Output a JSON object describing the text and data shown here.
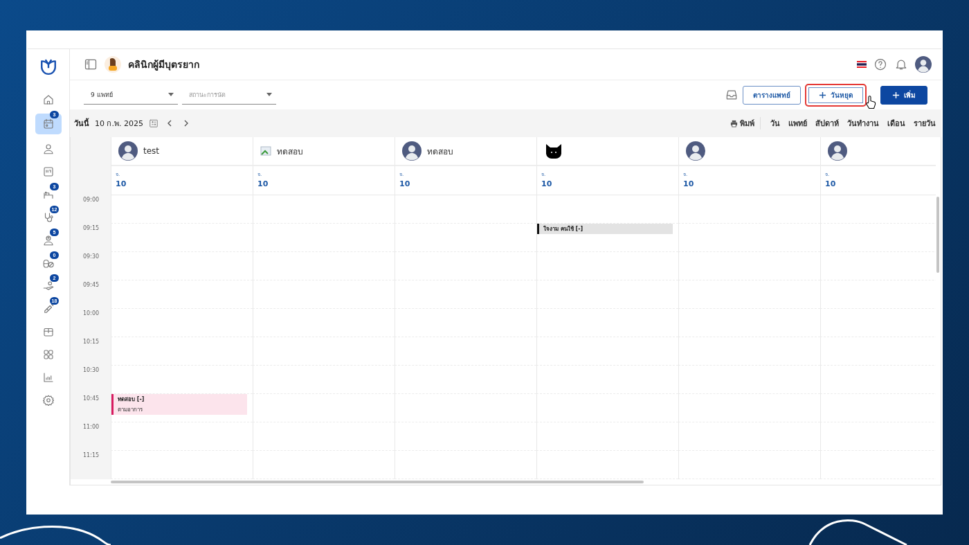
{
  "header": {
    "clinic_name": "คลินิกผู้มีบุตรยาก"
  },
  "sidebar": {
    "items": [
      {
        "kind": "home",
        "selected": false
      },
      {
        "kind": "calendar",
        "selected": true,
        "badge": "3"
      },
      {
        "kind": "person",
        "selected": false
      },
      {
        "kind": "card",
        "selected": false
      },
      {
        "kind": "bed",
        "selected": false,
        "badge": "3"
      },
      {
        "kind": "stethoscope",
        "selected": false,
        "badge": "12"
      },
      {
        "kind": "nurse",
        "selected": false,
        "badge": "5"
      },
      {
        "kind": "pills",
        "selected": false,
        "badge": "0"
      },
      {
        "kind": "hand",
        "selected": false,
        "badge": "2"
      },
      {
        "kind": "syringe",
        "selected": false,
        "badge": "18"
      },
      {
        "kind": "box",
        "selected": false
      },
      {
        "kind": "grid",
        "selected": false
      },
      {
        "kind": "chart",
        "selected": false
      },
      {
        "kind": "settings",
        "selected": false
      }
    ]
  },
  "filters": [
    {
      "value": "9 แพทย์"
    },
    {
      "placeholder": "สถานะการนัด"
    }
  ],
  "actions": [
    {
      "kind": "outline",
      "label": "ตารางแพทย์",
      "highlighted": false
    },
    {
      "kind": "outline-plus",
      "label": "วันหยุด",
      "highlighted": true
    },
    {
      "kind": "primary-plus",
      "label": "เพิ่ม",
      "highlighted": false
    }
  ],
  "date_bar": {
    "today_label": "วันนี้",
    "date": "10 ก.พ. 2025",
    "print_label": "พิมพ์",
    "views": [
      "วัน",
      "แพทย์",
      "สัปดาห์",
      "วันทำงาน",
      "เดือน",
      "รายวัน"
    ]
  },
  "doctors": [
    {
      "kind": "person",
      "name": "test",
      "weekday": "จ.",
      "day": "10"
    },
    {
      "kind": "broken-image",
      "name": "ทดสอบ",
      "weekday": "จ.",
      "day": "10"
    },
    {
      "kind": "person",
      "name": "ทดสอบ",
      "weekday": "จ.",
      "day": "10"
    },
    {
      "kind": "cat",
      "weekday": "จ.",
      "day": "10"
    },
    {
      "kind": "person",
      "weekday": "จ.",
      "day": "10"
    },
    {
      "kind": "person",
      "weekday": "จ.",
      "day": "10"
    }
  ],
  "rows": [
    {
      "time": "09:00",
      "cells": [
        {},
        {},
        {},
        {},
        {},
        {}
      ]
    },
    {
      "time": "09:15",
      "cells": [
        {},
        {},
        {},
        {
          "event": {
            "title": "ใจงาม คนใช้ [-]",
            "color": "#111111"
          }
        },
        {},
        {}
      ]
    },
    {
      "time": "09:30",
      "cells": [
        {},
        {},
        {},
        {},
        {},
        {}
      ]
    },
    {
      "time": "09:45",
      "cells": [
        {},
        {},
        {},
        {},
        {},
        {}
      ]
    },
    {
      "time": "10:00",
      "cells": [
        {},
        {},
        {},
        {},
        {},
        {}
      ]
    },
    {
      "time": "10:15",
      "cells": [
        {},
        {},
        {},
        {},
        {},
        {}
      ]
    },
    {
      "time": "10:30",
      "cells": [
        {},
        {},
        {},
        {},
        {},
        {}
      ]
    },
    {
      "time": "10:45",
      "cells": [
        {
          "event": {
            "title": "ทดสอบ [-]",
            "note": "ตามอาการ",
            "color": "#d81b60"
          }
        },
        {},
        {},
        {},
        {},
        {}
      ]
    },
    {
      "time": "11:00",
      "cells": [
        {},
        {},
        {},
        {},
        {},
        {}
      ]
    },
    {
      "time": "11:15",
      "cells": [
        {},
        {},
        {},
        {},
        {},
        {}
      ]
    }
  ]
}
